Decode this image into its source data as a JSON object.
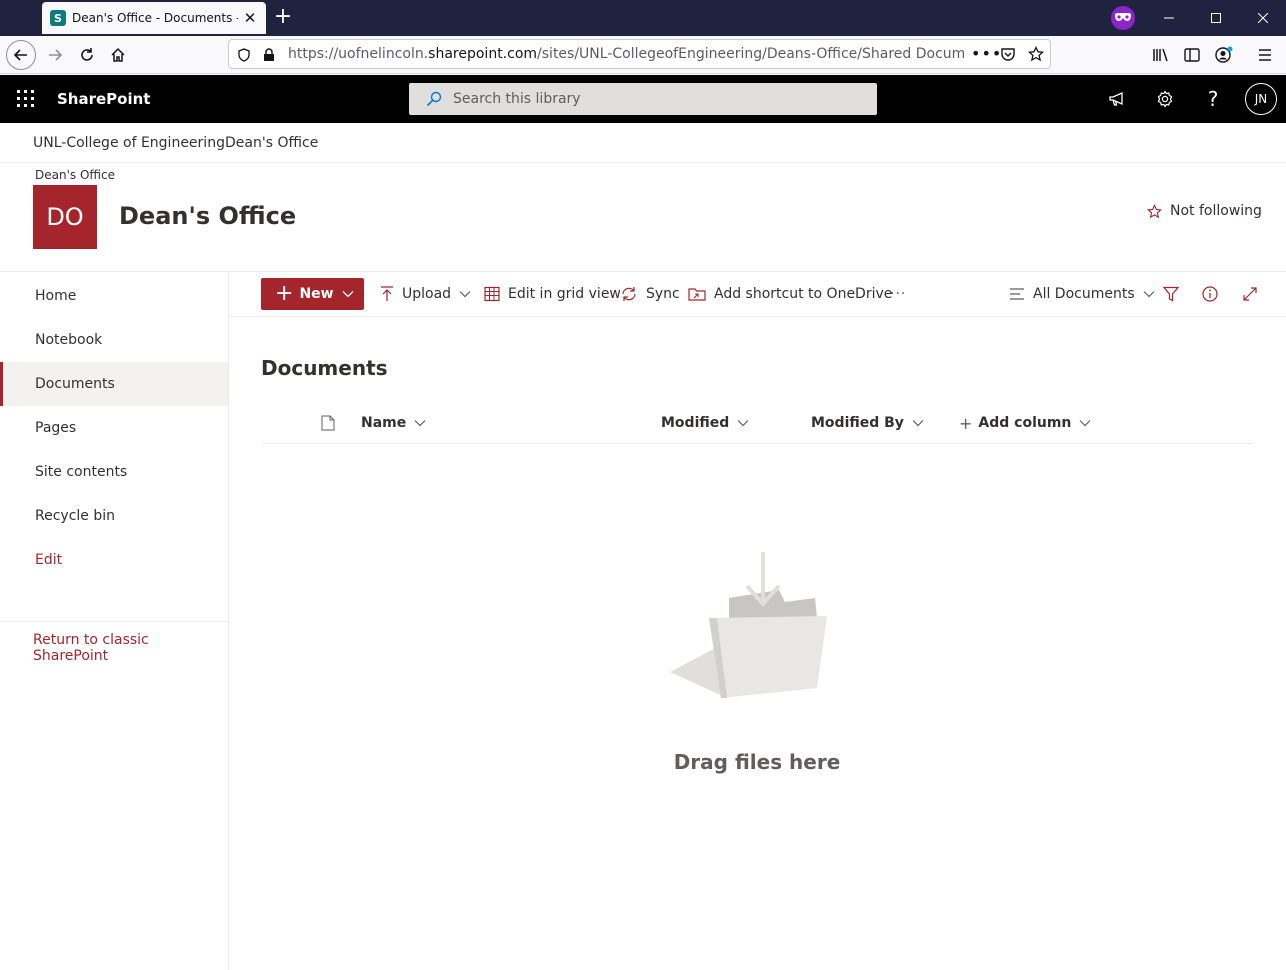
{
  "browser": {
    "tab_title": "Dean's Office - Documents - All Documents",
    "tab_favicon_letter": "S",
    "new_tab_label": "+",
    "url_prefix": "https://uofnelincoln.",
    "url_domain": "sharepoint.com",
    "url_path": "/sites/UNL-CollegeofEngineering/Deans-Office/Shared Documents/Forms/AllItems.aspx",
    "icons": [
      "back-icon",
      "forward-icon",
      "reload-icon",
      "home-icon",
      "shield-icon",
      "lock-icon",
      "more-icon",
      "pocket-icon",
      "bookmark-star-icon",
      "library-icon",
      "sidebar-icon",
      "account-icon",
      "menu-icon",
      "private-browsing-icon",
      "minimize-icon",
      "maximize-icon",
      "close-icon"
    ]
  },
  "suite": {
    "brand": "SharePoint",
    "search_placeholder": "Search this library",
    "user_initials": "JN",
    "icons": [
      "app-launcher-icon",
      "megaphone-icon",
      "settings-icon",
      "help-icon"
    ]
  },
  "hub_nav": {
    "items": [
      "UNL-College of Engineering",
      "Dean's Office"
    ]
  },
  "site": {
    "small_label": "Dean's Office",
    "logo_initials": "DO",
    "logo_color": "#a4262c",
    "title": "Dean's Office",
    "follow_label": "Not following"
  },
  "left_nav": {
    "items": [
      {
        "label": "Home",
        "selected": false
      },
      {
        "label": "Notebook",
        "selected": false
      },
      {
        "label": "Documents",
        "selected": true
      },
      {
        "label": "Pages",
        "selected": false
      },
      {
        "label": "Site contents",
        "selected": false
      },
      {
        "label": "Recycle bin",
        "selected": false
      }
    ],
    "edit_label": "Edit",
    "classic_label": "Return to classic SharePoint"
  },
  "command_bar": {
    "new_label": "New",
    "upload_label": "Upload",
    "grid_label": "Edit in grid view",
    "sync_label": "Sync",
    "shortcut_label": "Add shortcut to OneDrive",
    "more_label": "···",
    "view_label": "All Documents"
  },
  "library": {
    "heading": "Documents",
    "columns": {
      "name": "Name",
      "modified": "Modified",
      "modified_by": "Modified By",
      "add_column": "Add column"
    },
    "empty_message": "Drag files here"
  },
  "colors": {
    "accent": "#a4262c",
    "suite_bar": "#000000",
    "browser_frame": "#202340"
  }
}
